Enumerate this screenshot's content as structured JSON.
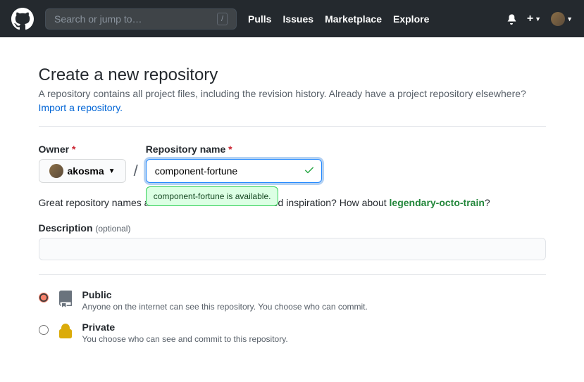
{
  "header": {
    "search_placeholder": "Search or jump to…",
    "slash": "/",
    "nav": {
      "pulls": "Pulls",
      "issues": "Issues",
      "marketplace": "Marketplace",
      "explore": "Explore"
    },
    "plus": "+"
  },
  "page": {
    "title": "Create a new repository",
    "subtitle": "A repository contains all project files, including the revision history. Already have a project repository elsewhere?",
    "import_link": "Import a repository."
  },
  "form": {
    "owner_label": "Owner",
    "owner_value": "akosma",
    "repo_label": "Repository name",
    "repo_value": "component-fortune",
    "availability_msg": "component-fortune is available.",
    "hint_prefix": "Great repository names are short and memorable. Need inspiration? How about ",
    "hint_suggestion": "legendary-octo-train",
    "hint_suffix": "?",
    "desc_label": "Description",
    "desc_optional": "(optional)",
    "slash": "/"
  },
  "visibility": {
    "public": {
      "title": "Public",
      "desc": "Anyone on the internet can see this repository. You choose who can commit."
    },
    "private": {
      "title": "Private",
      "desc": "You choose who can see and commit to this repository."
    }
  }
}
